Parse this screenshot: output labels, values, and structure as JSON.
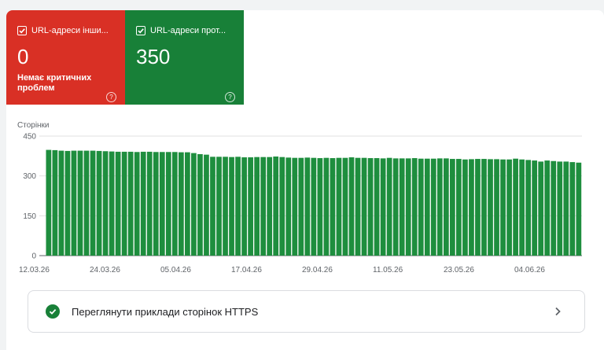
{
  "tiles": [
    {
      "label": "URL-адреси інши...",
      "value": "0",
      "sub": "Немає критичних проблем",
      "color": "#d93025",
      "checked": true
    },
    {
      "label": "URL-адреси прот...",
      "value": "350",
      "color": "#188038",
      "checked": true
    }
  ],
  "link": {
    "label": "Переглянути приклади сторінок HTTPS"
  },
  "chart_data": {
    "type": "bar",
    "ylabel": "Сторінки",
    "ylim": [
      0,
      450
    ],
    "yticks": [
      0,
      150,
      300,
      450
    ],
    "xtick_labels": [
      "12.03.26",
      "24.03.26",
      "05.04.26",
      "17.04.26",
      "29.04.26",
      "11.05.26",
      "23.05.26",
      "04.06.26"
    ],
    "bar_color": "#1e8e3e",
    "grid": true,
    "values": [
      398,
      397,
      395,
      394,
      395,
      395,
      395,
      395,
      394,
      393,
      392,
      391,
      391,
      391,
      390,
      391,
      391,
      390,
      390,
      390,
      390,
      389,
      389,
      386,
      382,
      380,
      372,
      372,
      372,
      371,
      372,
      370,
      370,
      371,
      371,
      371,
      373,
      371,
      369,
      368,
      368,
      369,
      368,
      367,
      368,
      367,
      368,
      368,
      370,
      368,
      368,
      367,
      367,
      366,
      368,
      366,
      366,
      366,
      367,
      365,
      365,
      365,
      366,
      366,
      364,
      364,
      362,
      363,
      364,
      364,
      363,
      363,
      362,
      362,
      365,
      362,
      360,
      358,
      354,
      358,
      356,
      354,
      354,
      352,
      350
    ]
  }
}
